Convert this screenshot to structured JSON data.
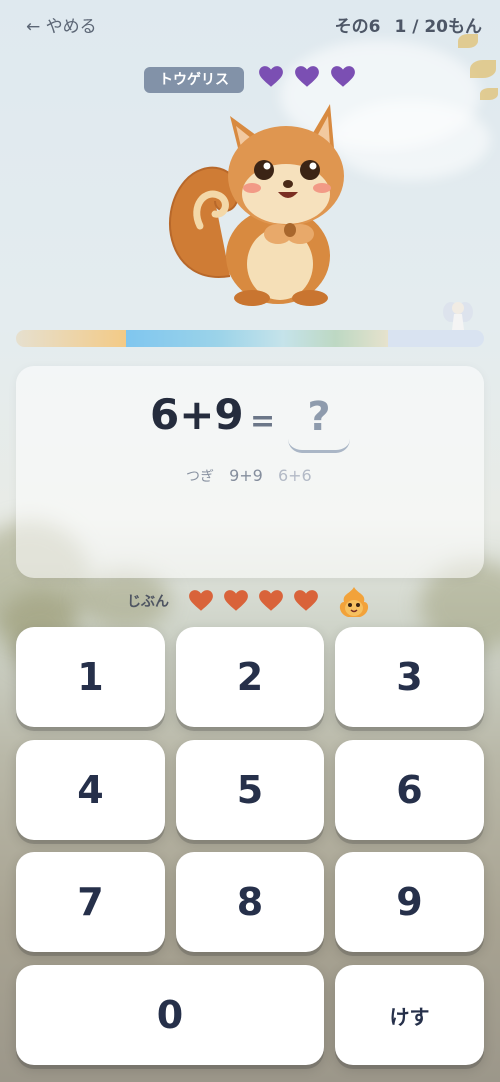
{
  "header": {
    "back_label": "← やめる",
    "round_label": "その6",
    "question_progress": "1 / 20もん"
  },
  "enemy": {
    "name": "トウゲリス",
    "hearts_remaining": 3,
    "heart_color": "#7b4fb3",
    "icon": "squirrel-character"
  },
  "enemy_hp_bar": {
    "icon": "fairy-icon"
  },
  "question": {
    "expression": "6+9",
    "equals": "=",
    "answer_placeholder": "?",
    "next_label": "つぎ",
    "next_items": [
      "9+9",
      "6+6"
    ]
  },
  "player": {
    "label": "じぶん",
    "hearts_remaining": 4,
    "heart_color": "#d9633a",
    "pet_icon": "fire-pet-icon"
  },
  "keypad": {
    "keys": [
      "1",
      "2",
      "3",
      "4",
      "5",
      "6",
      "7",
      "8",
      "9",
      "0"
    ],
    "clear_label": "けす"
  }
}
